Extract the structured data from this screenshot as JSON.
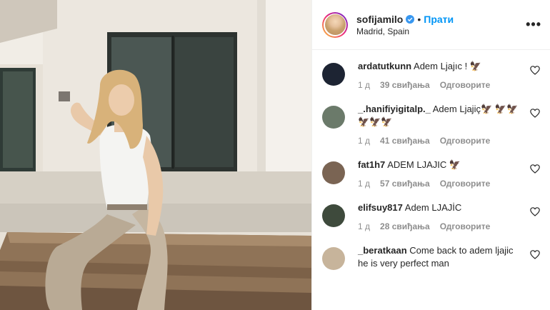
{
  "post": {
    "username": "sofijamilo",
    "follow_label": "Прати",
    "location": "Madrid, Spain",
    "more_label": "•••"
  },
  "comments": [
    {
      "user": "ardatutkunn",
      "text": "Adem Ljajıc ! 🦅",
      "time": "1 д",
      "likes": "39 свиђања",
      "reply": "Одговорите",
      "avatar_color": "#1d2433"
    },
    {
      "user": "_.hanifiyigitalp._",
      "text": "Adem Ljajiç🦅 🦅🦅🦅🦅🦅",
      "time": "1 д",
      "likes": "41 свиђања",
      "reply": "Одговорите",
      "avatar_color": "#6b7a6a"
    },
    {
      "user": "fat1h7",
      "text": "ADEM LJAJIC 🦅",
      "time": "1 д",
      "likes": "57 свиђања",
      "reply": "Одговорите",
      "avatar_color": "#7a6453"
    },
    {
      "user": "elifsuy817",
      "text": "Adem LJAJİC",
      "time": "1 д",
      "likes": "28 свиђања",
      "reply": "Одговорите",
      "avatar_color": "#3e4a3c"
    },
    {
      "user": "_beratkaan",
      "text": "Come back to adem ljajic he is very perfect man",
      "time": "",
      "likes": "",
      "reply": "",
      "avatar_color": "#c7b49b"
    }
  ]
}
